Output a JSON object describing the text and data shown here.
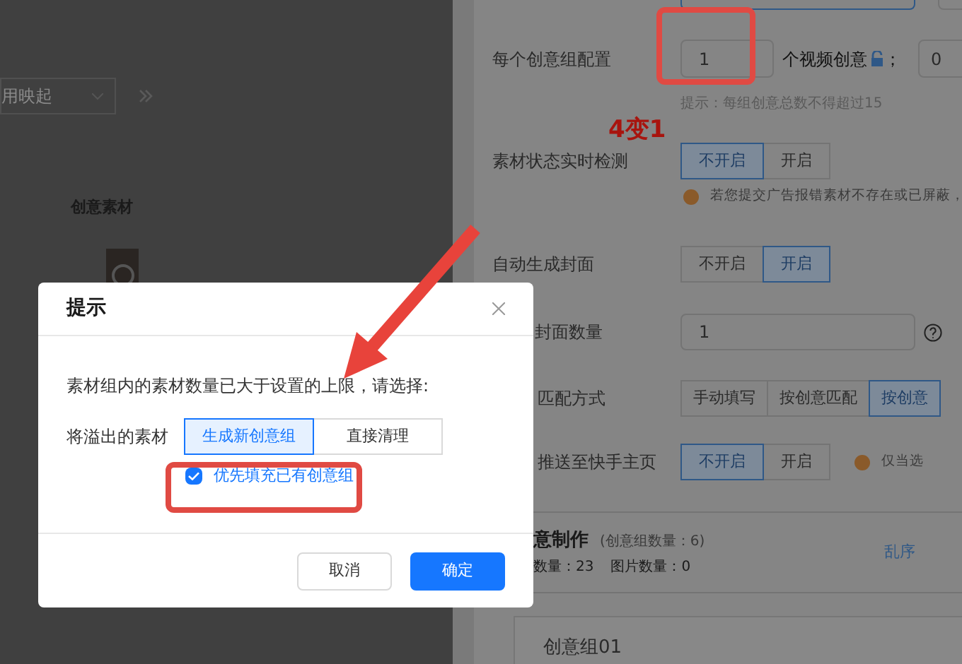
{
  "background": {
    "dropdown": {
      "value": "用映起"
    },
    "section_title": "创意素材"
  },
  "settings": {
    "group_config": {
      "label": "每个创意组配置",
      "video_count": "1",
      "unit": "个视频创意",
      "separator": "；",
      "image_count": "0",
      "hint": "提示：每组创意总数不得超过15"
    },
    "realtime_check": {
      "label": "素材状态实时检测",
      "options": [
        {
          "label": "不开启",
          "selected": true
        },
        {
          "label": "开启",
          "selected": false
        }
      ],
      "warning": "若您提交广告报错素材不存在或已屏蔽，"
    },
    "auto_cover": {
      "label": "自动生成封面",
      "options": [
        {
          "label": "不开启",
          "selected": false
        },
        {
          "label": "开启",
          "selected": true
        }
      ]
    },
    "cover_count": {
      "label": "封面数量",
      "value": "1"
    },
    "matching": {
      "label": "匹配方式",
      "options": [
        {
          "label": "手动填写",
          "selected": false
        },
        {
          "label": "按创意匹配",
          "selected": false
        },
        {
          "label": "按创意",
          "selected": true
        }
      ]
    },
    "push": {
      "label": "推送至快手主页",
      "options": [
        {
          "label": "不开启",
          "selected": true
        },
        {
          "label": "开启",
          "selected": false
        }
      ],
      "warning": "仅当选"
    },
    "production": {
      "title": "意制作",
      "group_count": "(创意组数量：6)",
      "video_count": "数量：23",
      "image_count": "图片数量：0",
      "shuffle_link": "乱序"
    },
    "group_card": {
      "title": "创意组01"
    }
  },
  "dialog": {
    "title": "提示",
    "message": "素材组内的素材数量已大于设置的上限，请选择:",
    "overflow_label": "将溢出的素材",
    "options": [
      {
        "label": "生成新创意组",
        "selected": true
      },
      {
        "label": "直接清理",
        "selected": false
      }
    ],
    "fill_existing": {
      "label": "优先填充已有创意组",
      "checked": true
    },
    "buttons": [
      {
        "label": "取消",
        "kind": "secondary"
      },
      {
        "label": "确定",
        "kind": "primary"
      }
    ]
  },
  "annotation": {
    "text": "4变1"
  }
}
